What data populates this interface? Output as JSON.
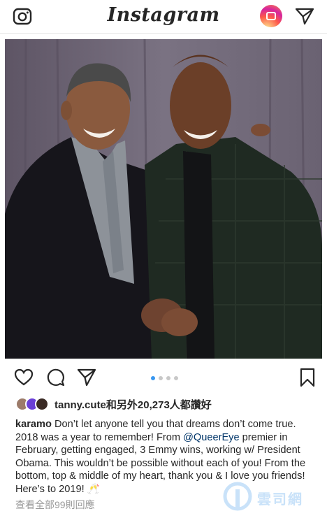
{
  "header": {
    "title": "Instagram",
    "icons": [
      "camera-icon",
      "igtv-icon",
      "direct-send-icon"
    ]
  },
  "post": {
    "image_alt": "Two men in dark suits smiling and shaking hands in front of a purple curtain",
    "carousel": {
      "count": 4,
      "active_index": 0,
      "active_color": "#3897f0"
    },
    "likes_text": "tanny.cute和另外20,273人都讚好",
    "caption": {
      "username": "karamo",
      "text_1": "Don’t let anyone tell you that dreams don’t come true. 2018 was a year to remember! From ",
      "mention": "@QueerEye",
      "text_2": " premier in February, getting engaged, 3 Emmy wins, working w/ President Obama. This wouldn’t be possible without each of you! From the bottom, top & middle of my heart, thank you & I love you friends! Here’s to 2019! 🥂"
    },
    "view_comments": "查看全部99則回應"
  },
  "watermark": {
    "text": "雲司網"
  },
  "colors": {
    "link": "#003569",
    "muted": "#999999",
    "accent": "#3897f0"
  }
}
